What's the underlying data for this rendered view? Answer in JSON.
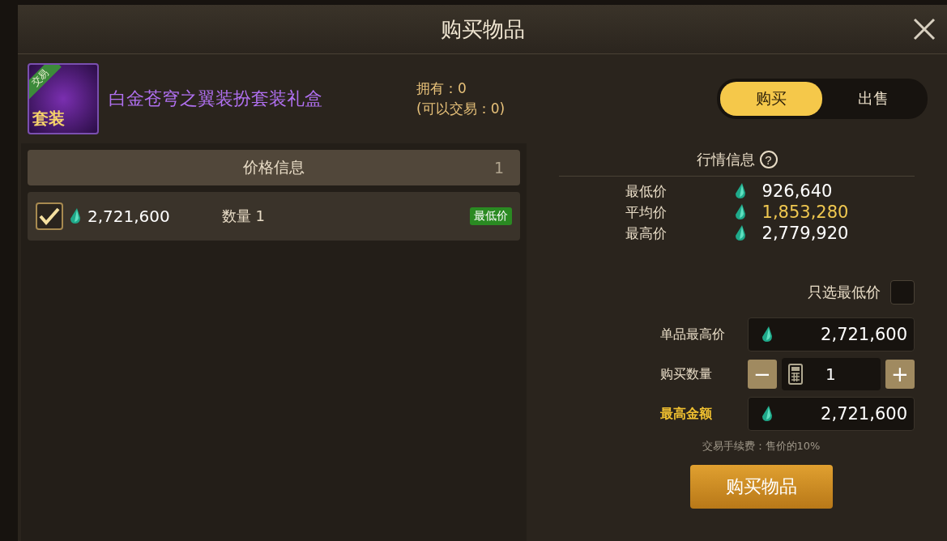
{
  "window": {
    "title": "购买物品"
  },
  "item": {
    "name": "白金苍穹之翼装扮套装礼盒",
    "tag": "交易",
    "set_label": "套装",
    "owned": "拥有：0",
    "tradable": "(可以交易：0)"
  },
  "mode_tabs": [
    {
      "label": "购买",
      "selected": true
    },
    {
      "label": "出售",
      "selected": false
    }
  ],
  "price_list": {
    "title": "价格信息",
    "count": "1",
    "rows": [
      {
        "checked": true,
        "price": "2,721,600",
        "quantity": "数量 1",
        "badge": "最低价"
      }
    ]
  },
  "market": {
    "title": "行情信息",
    "help": "?",
    "rows": [
      {
        "label": "最低价",
        "value": "926,640",
        "highlight": false
      },
      {
        "label": "平均价",
        "value": "1,853,280",
        "highlight": true
      },
      {
        "label": "最高价",
        "value": "2,779,920",
        "highlight": false
      }
    ]
  },
  "lowest_only": {
    "label": "只选最低价",
    "checked": false
  },
  "max_unit_price": {
    "label": "单品最高价",
    "value": "2,721,600"
  },
  "quantity": {
    "label": "购买数量",
    "minus": "−",
    "value": "1",
    "plus": "+"
  },
  "max_total": {
    "label": "最高金额",
    "value": "2,721,600"
  },
  "fee_note": "交易手续费：售价的10%",
  "buy_button": "购买物品"
}
